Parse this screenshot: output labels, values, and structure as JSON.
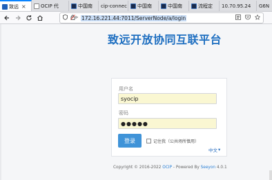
{
  "browser": {
    "tabs": [
      {
        "label": "致远",
        "favicon": "seeyon-icon",
        "active": true,
        "has_close": true
      },
      {
        "label": "OCIP 代",
        "favicon": "globe-icon",
        "active": false
      },
      {
        "label": "中国南",
        "favicon": "csg-icon",
        "active": false
      },
      {
        "label": "cip-connec",
        "favicon": "none",
        "active": false
      },
      {
        "label": "中国南",
        "favicon": "csg-icon",
        "active": false
      },
      {
        "label": "中国南",
        "favicon": "csg-icon",
        "active": false
      },
      {
        "label": "流程定",
        "favicon": "csg-icon",
        "active": false
      },
      {
        "label": "10.70.95.24",
        "favicon": "none",
        "active": false
      },
      {
        "label": "G6N",
        "favicon": "none",
        "active": false
      }
    ],
    "url": "172.16.221.44:7011/ServerNode/a/login",
    "close_glyph": "×"
  },
  "login": {
    "platform_title": "致远开放协同互联平台",
    "username_label": "用户名",
    "username_value": "syocip",
    "password_label": "密码",
    "password_value": "●●●●●",
    "login_button": "登录",
    "remember_label": "记住我（公共场所慎用）",
    "language": "中文",
    "language_arrow": "▾"
  },
  "footer": {
    "prefix": "Copyright © 2016-2022 ",
    "ocip_link": "OCIP",
    "middle": " - Powered By ",
    "seeyon_link": "Seeyon",
    "version": " 4.0.1"
  },
  "colors": {
    "accent": "#1d6ec0",
    "button": "#3f93d8",
    "autofill": "#faf7d2"
  }
}
